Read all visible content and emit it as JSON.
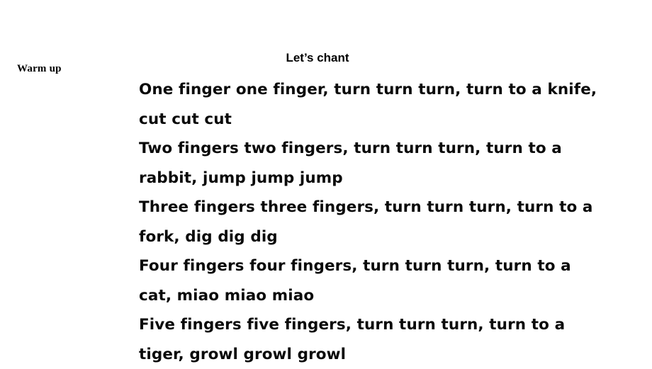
{
  "slide": {
    "background_color": "#ffffff",
    "text_color": "#000000",
    "section_label": "Warm up",
    "title": "Let’s chant"
  },
  "chant": {
    "title": "Let’s chant",
    "verses": [
      {
        "number": "One",
        "animal": "knife",
        "sound": "cut cut cut",
        "lines": [
          "One finger one finger, turn turn turn, turn to a knife,",
          "cut cut cut"
        ]
      },
      {
        "number": "Two",
        "animal": "rabbit",
        "sound": "jump jump jump",
        "lines": [
          "Two fingers two fingers, turn turn turn, turn to a",
          "rabbit, jump jump jump"
        ]
      },
      {
        "number": "Three",
        "animal": "fork",
        "sound": "dig dig dig",
        "lines": [
          "Three fingers three fingers, turn turn turn, turn to a",
          "fork, dig dig dig"
        ]
      },
      {
        "number": "Four",
        "animal": "cat",
        "sound": "miao miao miao",
        "lines": [
          "Four fingers four fingers, turn turn turn, turn to a",
          "cat, miao miao miao"
        ]
      },
      {
        "number": "Five",
        "animal": "tiger",
        "sound": "growl growl growl",
        "lines": [
          "Five fingers five fingers, turn turn turn, turn to a",
          "tiger, growl growl growl"
        ]
      }
    ],
    "all_lines": [
      "One finger one finger, turn turn turn, turn to a knife,",
      "cut cut cut",
      "Two fingers two fingers, turn turn turn, turn to a",
      "rabbit, jump jump jump",
      "Three fingers three fingers, turn turn turn, turn to a",
      "fork, dig dig dig",
      "Four fingers four fingers, turn turn turn, turn to a",
      "cat, miao miao miao",
      "Five fingers five fingers, turn turn turn, turn to a",
      "tiger, growl growl growl"
    ]
  }
}
